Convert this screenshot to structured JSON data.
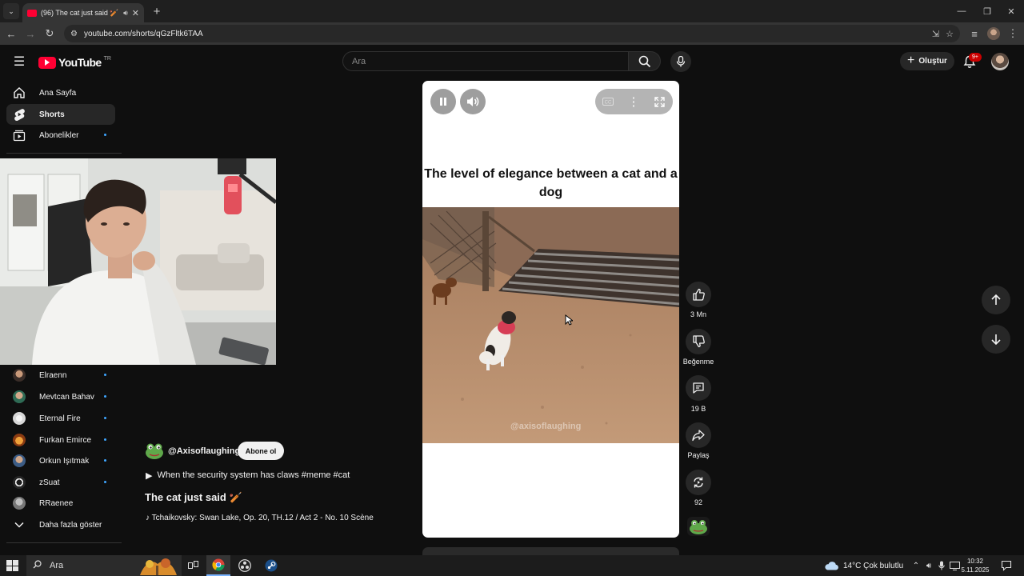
{
  "browser": {
    "tab_title": "(96) The cat just said 🏏 - YouTube",
    "url": "youtube.com/shorts/qGzFltk6TAA"
  },
  "header": {
    "logo_text": "YouTube",
    "country_code": "TR",
    "search_placeholder": "Ara",
    "create_label": "Oluştur",
    "notification_count": "9+"
  },
  "sidebar": {
    "items": [
      {
        "label": "Ana Sayfa",
        "icon": "home-icon"
      },
      {
        "label": "Shorts",
        "icon": "shorts-icon",
        "active": true
      },
      {
        "label": "Abonelikler",
        "icon": "subscriptions-icon"
      }
    ],
    "subscriptions": [
      {
        "label": "Elraenn"
      },
      {
        "label": "Mevtcan Bahav"
      },
      {
        "label": "Eternal Fire"
      },
      {
        "label": "Furkan Emirce"
      },
      {
        "label": "Orkun Işıtmak"
      },
      {
        "label": "zSuat"
      },
      {
        "label": "RRaenee"
      }
    ],
    "show_more": "Daha fazla göster"
  },
  "short": {
    "channel": "@Axisoflaughing",
    "subscribe_label": "Abone ol",
    "description": "When the security system has claws #meme #cat",
    "title": "The cat just said 🏏",
    "music": "Tchaikovsky: Swan Lake, Op. 20, TH.12 / Act 2 - No. 10 Scène",
    "caption": "The level of elegance between a cat and a dog",
    "watermark": "@axisoflaughing"
  },
  "actions": {
    "likes": "3 Mn",
    "dislike_label": "Beğenme",
    "comments": "19 B",
    "share_label": "Paylaş",
    "remix_count": "92"
  },
  "taskbar": {
    "search_label": "Ara",
    "weather": "14°C  Çok bulutlu",
    "time": "10:32",
    "date": "5.11.2025"
  },
  "colors": {
    "brand_red": "#ff0033",
    "page_bg": "#0f0f0f",
    "accent_blue": "#3ea6ff"
  }
}
